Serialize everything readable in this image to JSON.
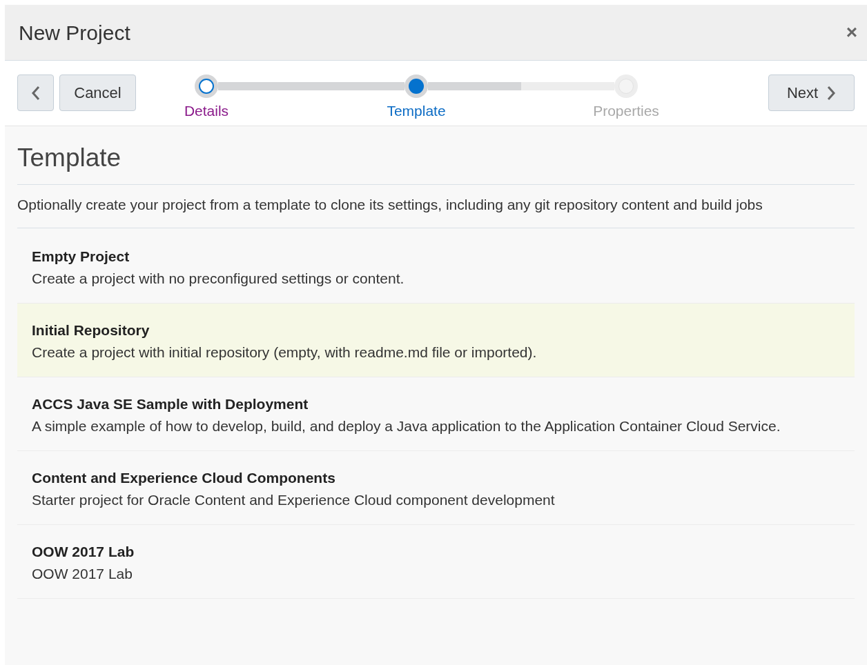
{
  "dialog": {
    "title": "New Project",
    "close": "×"
  },
  "toolbar": {
    "cancel": "Cancel",
    "next": "Next"
  },
  "steps": [
    {
      "label": "Details",
      "selected": false,
      "disabled": false
    },
    {
      "label": "Template",
      "selected": true,
      "disabled": false
    },
    {
      "label": "Properties",
      "selected": false,
      "disabled": true
    }
  ],
  "section": {
    "heading": "Template",
    "description": "Optionally create your project from a template to clone its settings, including any git repository content and build jobs"
  },
  "templates": [
    {
      "name": "Empty Project",
      "description": "Create a project with no preconfigured settings or content.",
      "selected": false
    },
    {
      "name": "Initial Repository",
      "description": "Create a project with initial repository (empty, with readme.md file or imported).",
      "selected": true
    },
    {
      "name": "ACCS Java SE Sample with Deployment",
      "description": "A simple example of how to develop, build, and deploy a Java application to the Application Container Cloud Service.",
      "selected": false
    },
    {
      "name": "Content and Experience Cloud Components",
      "description": "Starter project for Oracle Content and Experience Cloud component development",
      "selected": false
    },
    {
      "name": "OOW 2017 Lab",
      "description": "OOW 2017 Lab",
      "selected": false
    }
  ]
}
